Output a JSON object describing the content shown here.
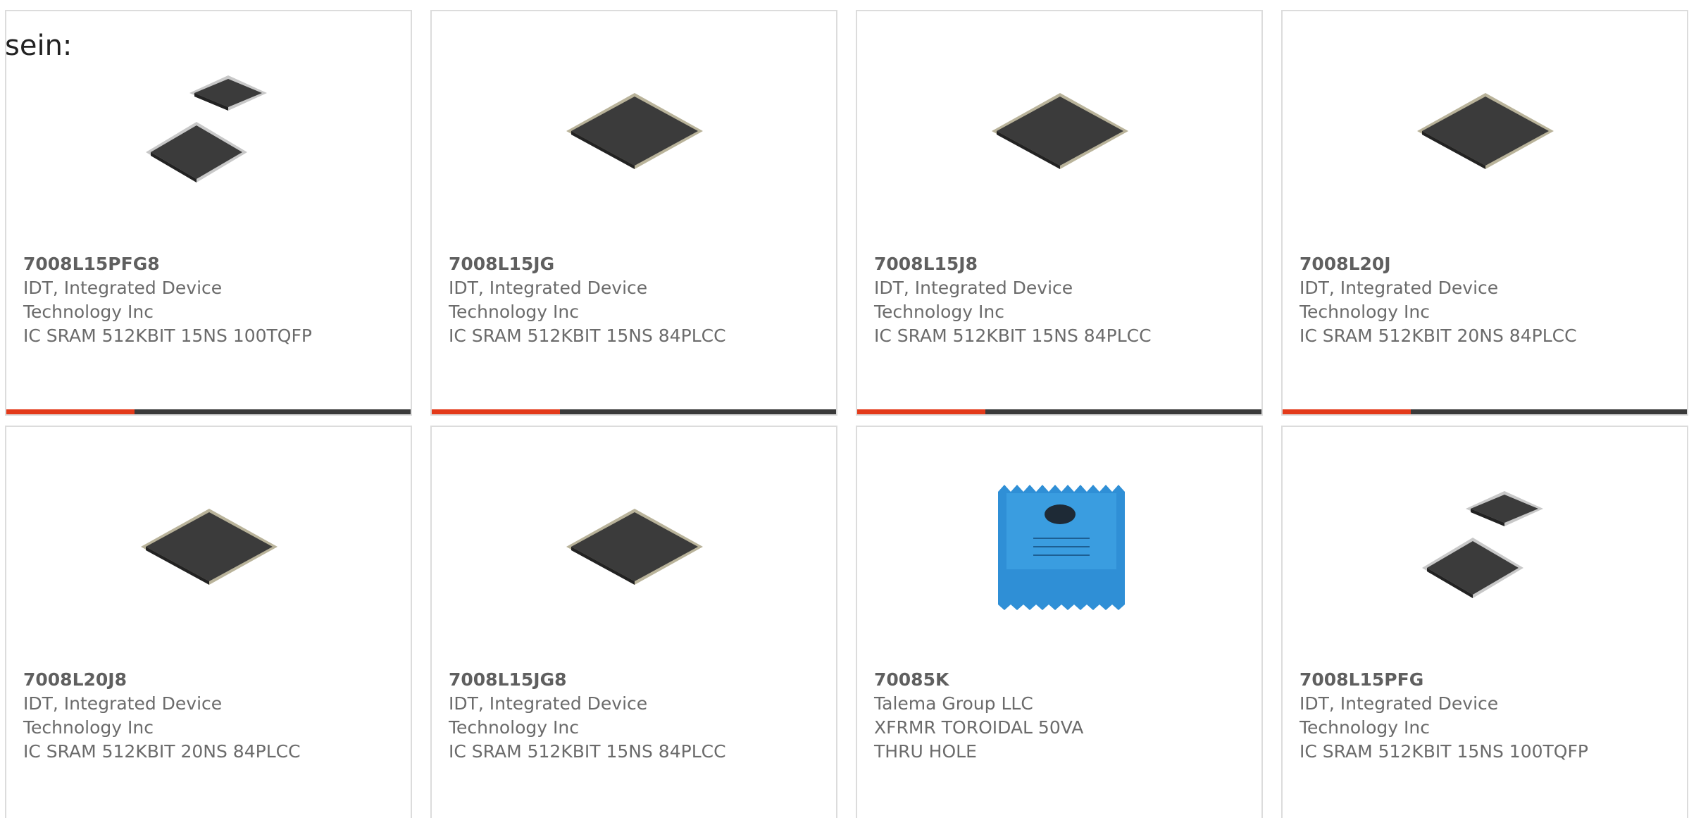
{
  "intro_text": "sein:",
  "colors": {
    "accent": "#e33a1a",
    "bar": "#3a3a3a",
    "border": "#dcdcdc",
    "chip": "#3b3b3b",
    "transformer": "#2f8fd6"
  },
  "products": [
    {
      "part_number": "7008L15PFG8",
      "manufacturer": "IDT, Integrated Device Technology Inc",
      "description": "IC SRAM 512KBIT 15NS 100TQFP",
      "icon": "tqfp-chip-pair-icon"
    },
    {
      "part_number": "7008L15JG",
      "manufacturer": "IDT, Integrated Device Technology Inc",
      "description": "IC SRAM 512KBIT 15NS 84PLCC",
      "icon": "plcc-chip-icon"
    },
    {
      "part_number": "7008L15J8",
      "manufacturer": "IDT, Integrated Device Technology Inc",
      "description": "IC SRAM 512KBIT 15NS 84PLCC",
      "icon": "plcc-chip-icon"
    },
    {
      "part_number": "7008L20J",
      "manufacturer": "IDT, Integrated Device Technology Inc",
      "description": "IC SRAM 512KBIT 20NS 84PLCC",
      "icon": "plcc-chip-icon"
    },
    {
      "part_number": "7008L20J8",
      "manufacturer": "IDT, Integrated Device Technology Inc",
      "description": "IC SRAM 512KBIT 20NS 84PLCC",
      "icon": "plcc-chip-icon"
    },
    {
      "part_number": "7008L15JG8",
      "manufacturer": "IDT, Integrated Device Technology Inc",
      "description": "IC SRAM 512KBIT 15NS 84PLCC",
      "icon": "plcc-chip-icon"
    },
    {
      "part_number": "70085K",
      "manufacturer": "Talema Group LLC",
      "description": "XFRMR TOROIDAL 50VA THRU HOLE",
      "icon": "toroidal-transformer-icon"
    },
    {
      "part_number": "7008L15PFG",
      "manufacturer": "IDT, Integrated Device Technology Inc",
      "description": "IC SRAM 512KBIT 15NS 100TQFP",
      "icon": "tqfp-chip-pair-icon"
    }
  ]
}
